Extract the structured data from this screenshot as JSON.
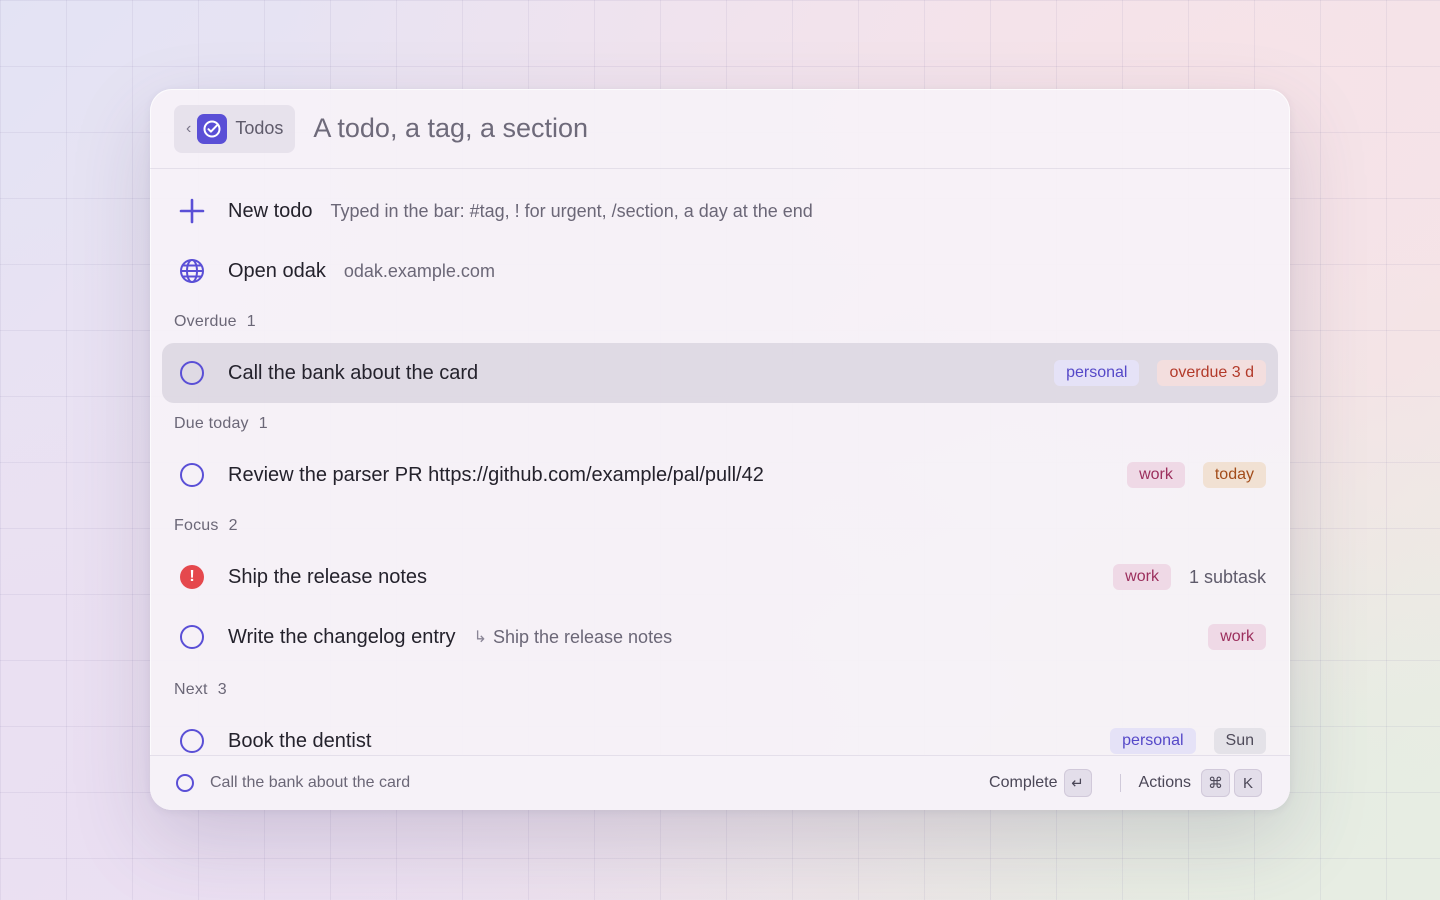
{
  "header": {
    "back_label": "Todos",
    "back_chevron": "‹",
    "search_placeholder": "A todo, a tag, a section"
  },
  "commands": [
    {
      "title": "New todo",
      "subtitle": "Typed in the bar: #tag, ! for urgent, /section, a day at the end",
      "icon": "plus-icon"
    },
    {
      "title": "Open odak",
      "subtitle": "odak.example.com",
      "icon": "globe-icon"
    }
  ],
  "sections": {
    "overdue": {
      "label": "Overdue",
      "count": "1"
    },
    "due_today": {
      "label": "Due today",
      "count": "1"
    },
    "focus": {
      "label": "Focus",
      "count": "2"
    },
    "next": {
      "label": "Next",
      "count": "3"
    }
  },
  "todos": {
    "bank": {
      "title": "Call the bank about the card",
      "tag": "personal",
      "due": "overdue 3 d"
    },
    "parser": {
      "title": "Review the parser PR https://github.com/example/pal/pull/42",
      "tag": "work",
      "due": "today"
    },
    "release": {
      "title": "Ship the release notes",
      "tag": "work",
      "meta": "1 subtask",
      "urgent_glyph": "!"
    },
    "changelog": {
      "title": "Write the changelog entry",
      "parent_glyph": "↳",
      "parent": "Ship the release notes",
      "tag": "work"
    },
    "dentist": {
      "title": "Book the dentist",
      "tag": "personal",
      "due": "Sun"
    }
  },
  "footer": {
    "selected_title": "Call the bank about the card",
    "primary_action": "Complete",
    "primary_key": "↵",
    "secondary_action": "Actions",
    "secondary_keys": [
      "⌘",
      "K"
    ]
  },
  "colors": {
    "accent": "#5a4fd6",
    "urgent": "#e5484d"
  }
}
